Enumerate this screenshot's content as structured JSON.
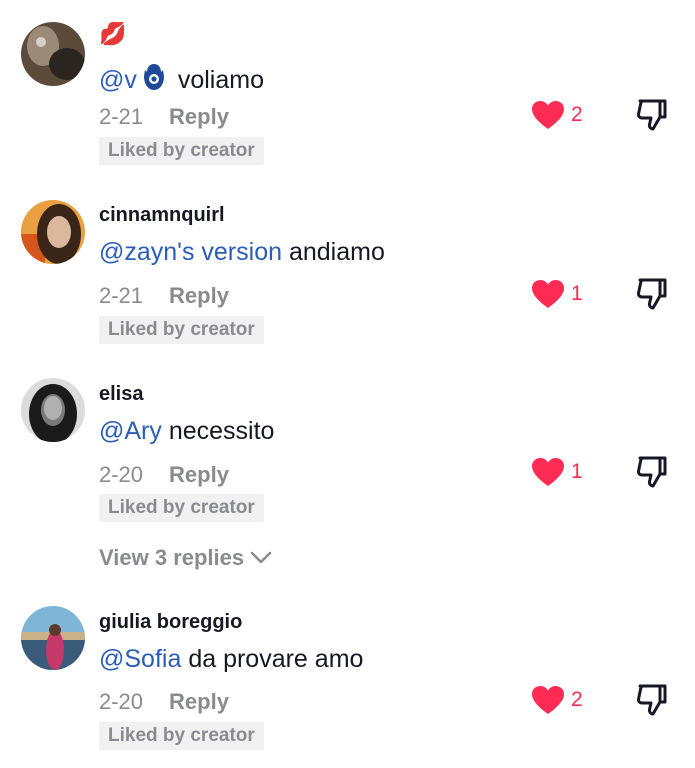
{
  "comments": [
    {
      "username": "",
      "emoji": "💋",
      "mention": "@v",
      "mention_suffix_icon": "hamsa-icon",
      "text": " voliamo",
      "date": "2-21",
      "reply_label": "Reply",
      "liked_badge": "Liked by creator",
      "like_count": "2",
      "avatar_colors": [
        "#5c4a3a",
        "#9c8a78",
        "#2b2520"
      ]
    },
    {
      "username": "cinnamnquirl",
      "mention": "@zayn's version",
      "text": " andiamo",
      "date": "2-21",
      "reply_label": "Reply",
      "liked_badge": "Liked by creator",
      "like_count": "1",
      "avatar_colors": [
        "#e8a040",
        "#3a2618",
        "#d9b89c"
      ]
    },
    {
      "username": "elisa",
      "mention": "@Ary",
      "text": " necessito",
      "date": "2-20",
      "reply_label": "Reply",
      "liked_badge": "Liked by creator",
      "like_count": "1",
      "view_replies": "View 3 replies",
      "avatar_colors": [
        "#1a1a1a",
        "#7a7a7a",
        "#dcdcdc"
      ]
    },
    {
      "username": "giulia boreggio",
      "mention": "@Sofia",
      "text": " da provare amo",
      "date": "2-20",
      "reply_label": "Reply",
      "liked_badge": "Liked by creator",
      "like_count": "2",
      "avatar_colors": [
        "#7fb6d8",
        "#c4386a",
        "#3a5a7a"
      ]
    }
  ],
  "colors": {
    "mention": "#2b5db9",
    "heart": "#fe2c55",
    "muted": "#8a8b91",
    "badge_bg": "#f1f1f2"
  }
}
